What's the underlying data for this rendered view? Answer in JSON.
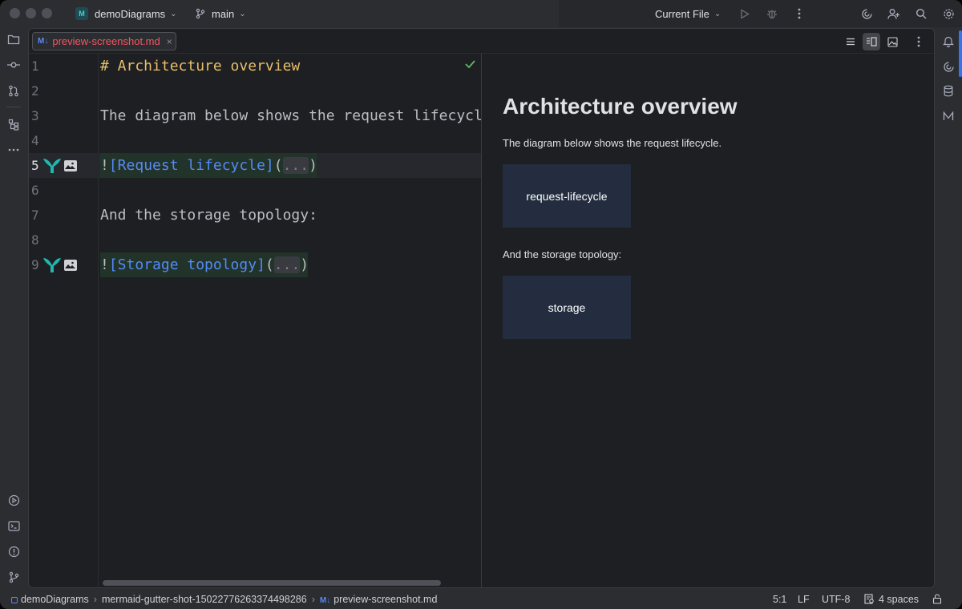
{
  "titlebar": {
    "project_badge": "M",
    "project": "demoDiagrams",
    "branch": "main",
    "run_config": "Current File"
  },
  "tab": {
    "badge": "M↓",
    "label": "preview-screenshot.md",
    "close": "×"
  },
  "editor": {
    "line_numbers": [
      "1",
      "2",
      "3",
      "4",
      "5",
      "6",
      "7",
      "8",
      "9"
    ],
    "line1_heading": "# Architecture overview",
    "line3_text": "The diagram below shows the request lifecycl",
    "line5": {
      "bang": "!",
      "link": "[Request lifecycle]",
      "open": "(",
      "dots": "...",
      "close": ")"
    },
    "line7_text": "And the storage topology:",
    "line9": {
      "bang": "!",
      "link": "[Storage topology]",
      "open": "(",
      "dots": "...",
      "close": ")"
    }
  },
  "preview": {
    "heading": "Architecture overview",
    "para1": "The diagram below shows the request lifecycle.",
    "diagram1": "request-lifecycle",
    "para2": "And the storage topology:",
    "diagram2": "storage"
  },
  "statusbar": {
    "project": "demoDiagrams",
    "folder": "mermaid-gutter-shot-15022776263374498286",
    "file_badge": "M↓",
    "file": "preview-screenshot.md",
    "position": "5:1",
    "line_ending": "LF",
    "encoding": "UTF-8",
    "indent": "4 spaces"
  },
  "icons": {
    "mermaid": "mermaid-diagram-icon",
    "image": "image-preview-icon",
    "run": "run-icon",
    "debug": "debug-icon"
  },
  "colors": {
    "accent": "#3574f0",
    "mermaid_teal": "#1fb8b0",
    "link": "#548af7",
    "heading": "#e8bf6a",
    "check": "#5fb865"
  }
}
